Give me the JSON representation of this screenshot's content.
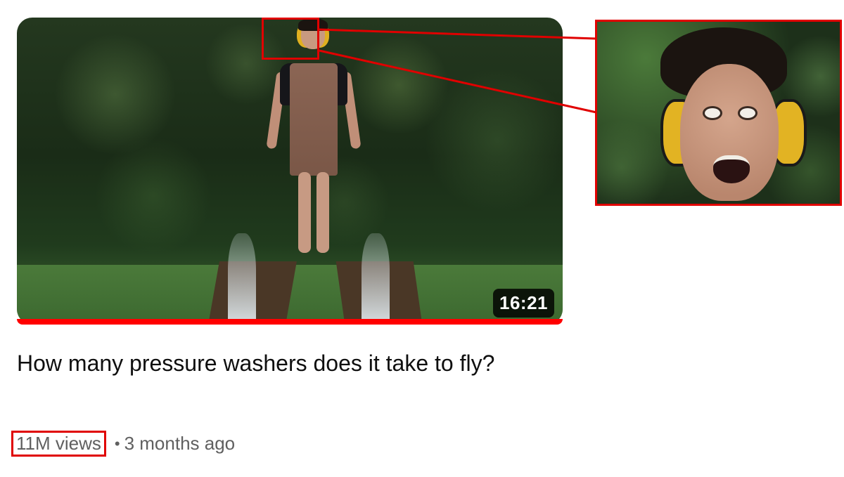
{
  "video": {
    "duration": "16:21",
    "title": "How many pressure washers does it take to fly?",
    "views": "11M views",
    "separator": "•",
    "age": "3 months ago",
    "watch_progress_percent": 100
  },
  "annotation": {
    "highlight_color": "#e00000",
    "zoom_subject": "face-with-ear-defenders"
  },
  "colors": {
    "progress": "#ff0000",
    "title_text": "#0f0f0f",
    "meta_text": "#606060"
  }
}
